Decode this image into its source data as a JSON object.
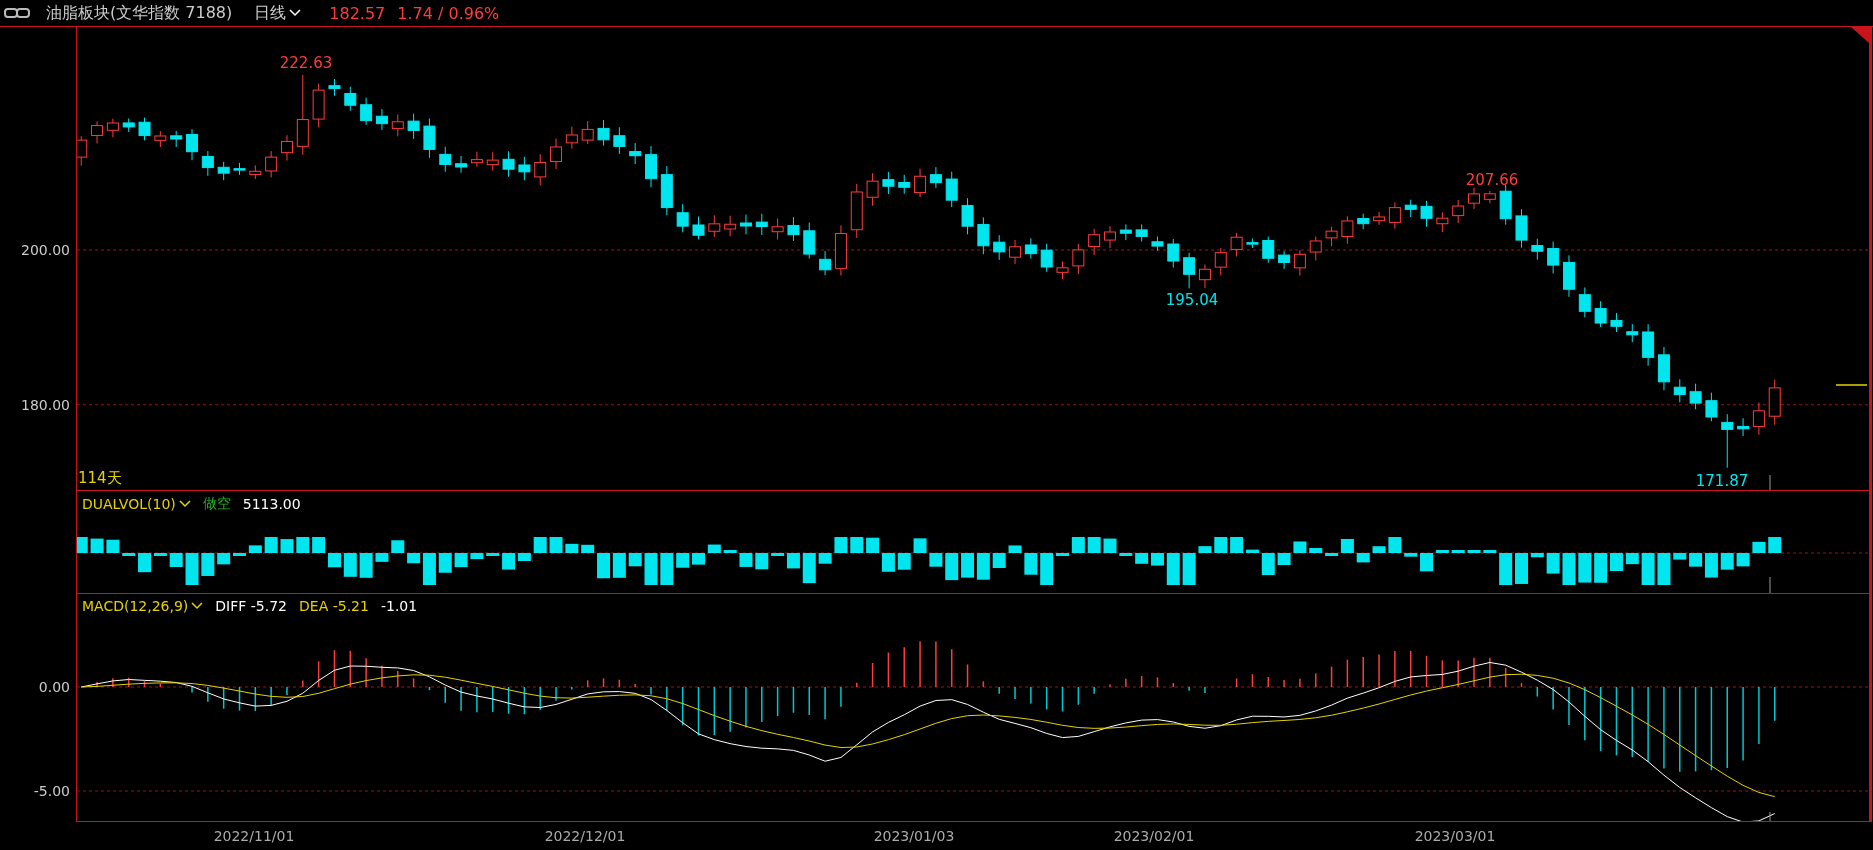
{
  "header": {
    "title": "油脂板块(文华指数 7188)",
    "period": "日线",
    "price": "182.57",
    "change": "1.74 / 0.96%"
  },
  "price_panel": {
    "axis_labels": [
      "200.00",
      "180.00"
    ],
    "days": "114天",
    "marks": [
      {
        "text": "222.63",
        "kind": "high"
      },
      {
        "text": "207.66",
        "kind": "high"
      },
      {
        "text": "195.04",
        "kind": "low"
      },
      {
        "text": "171.87",
        "kind": "low"
      }
    ]
  },
  "volume_panel": {
    "indicator": "DUALVOL(10)",
    "signal": "做空",
    "value": "5113.00"
  },
  "macd_panel": {
    "indicator": "MACD(12,26,9)",
    "diff": "DIFF -5.72",
    "dea": "DEA -5.21",
    "macd": "-1.01",
    "axis_labels": [
      "0.00",
      "-5.00"
    ]
  },
  "dates": [
    "2022/11/01",
    "2022/12/01",
    "2023/01/03",
    "2023/02/01",
    "2023/03/01"
  ]
}
